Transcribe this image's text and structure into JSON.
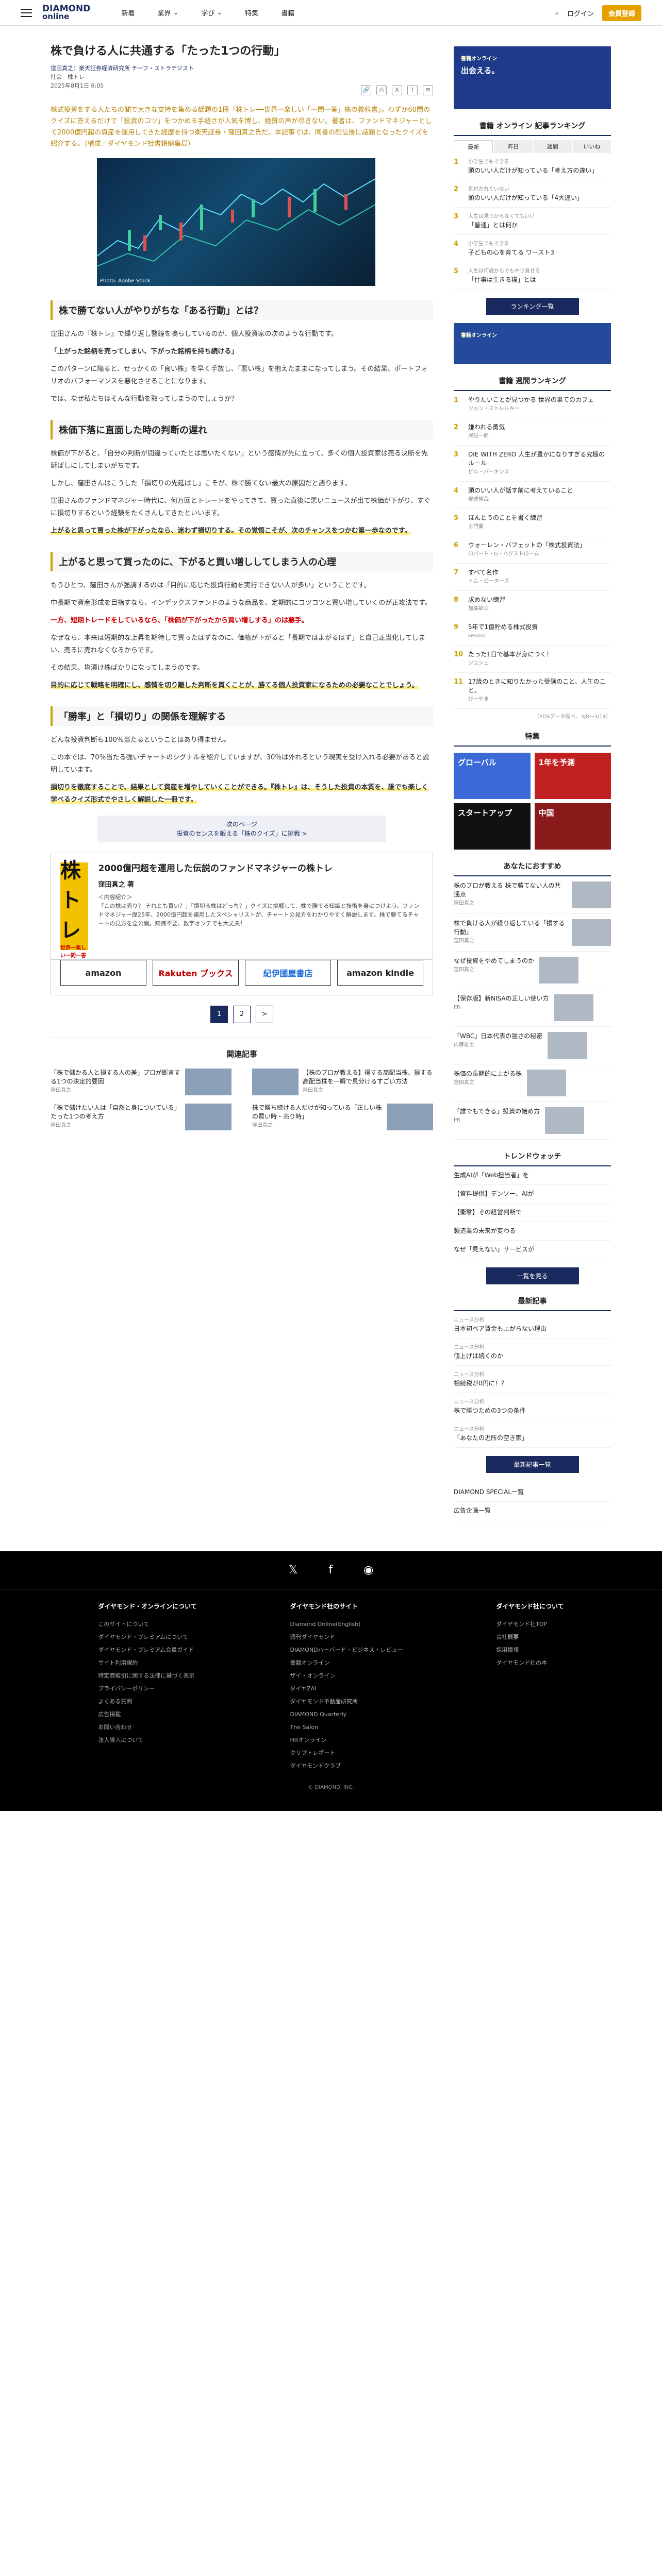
{
  "header": {
    "logo1": "DIAMOND",
    "logo2": "online",
    "nav": [
      "新着",
      "業界",
      "学び",
      "特集",
      "書籍"
    ],
    "login": "ログイン",
    "register": "会員登録"
  },
  "article": {
    "title": "株で負ける人に共通する「たった1つの行動」",
    "author": "窪田真之：楽天証券経済研究所 チーフ・ストラテジスト",
    "sub": "社会　株トレ",
    "date": "2025年8月1日 6:05",
    "lead": "株式投資をする人たちの間で大きな支持を集める話題の1冊『株トレ──世界一楽しい「一問一答」株の教科書』。わずか60問のクイズに答えるだけで「投資のコツ」をつかめる手軽さが人気を博し、絶賛の声が尽きない。著者は、ファンドマネジャーとして2000億円超の資産を運用してきた経歴を持つ楽天証券・窪田真之氏だ。本記事では、同書の配信後に話題となったクイズを紹介する。（構成／ダイヤモンド社書籍編集局）",
    "caption": "Photo: Adobe Stock",
    "h1": "株で勝てない人がやりがちな「ある行動」とは？",
    "p1": "窪田さんの『株トレ』で繰り返し警鐘を鳴らしているのが、個人投資家の次のような行動です。",
    "p2": "「上がった銘柄を売ってしまい、下がった銘柄を持ち続ける」",
    "p3": "このパターンに陥ると、せっかくの「良い株」を早く手放し、「悪い株」を抱えたままになってしまう。その結果、ポートフォリオのパフォーマンスを悪化させることになります。",
    "p4": "では、なぜ私たちはそんな行動を取ってしまうのでしょうか？",
    "h2": "株価下落に直面した時の判断の遅れ",
    "p5": "株価が下がると、「自分の判断が間違っていたとは思いたくない」という感情が先に立って、多くの個人投資家は売る決断を先延ばしにしてしまいがちです。",
    "p6": "しかし、窪田さんはこうした「損切りの先延ばし」こそが、株で勝てない最大の原因だと語ります。",
    "p7": "窪田さんのファンドマネジャー時代に、何万回とトレードをやってきて、買った直後に悪いニュースが出て株価が下がり、すぐに損切りするという経験をたくさんしてきたといいます。",
    "p8": "上がると思って買った株が下がったなら、迷わず損切りする。その覚悟こそが、次のチャンスをつかむ第一歩なのです。",
    "h3": "上がると思って買ったのに、下がると買い増ししてしまう人の心理",
    "p9": "もうひとつ、窪田さんが強調するのは「目的に応じた投資行動を実行できない人が多い」ということです。",
    "p10": "中長期で資産形成を目指すなら、インデックスファンドのような商品を、定期的にコツコツと買い増していくのが正攻法です。",
    "p11": "一方、短期トレードをしているなら、「株価が下がったから買い増しする」のは悪手。",
    "p12": "なぜなら、本来は短期的な上昇を期待して買ったはずなのに、価格が下がると「長期ではよがるはず」と自己正当化してしまい、売るに売れなくなるからです。",
    "p13": "その結果、塩漬け株ばかりになってしまうのです。",
    "p14": "目的に応じて戦略を明確にし、感情を切り離した判断を貫くことが、勝てる個人投資家になるための必要なことでしょう。",
    "h4": "「勝率」と「損切り」の関係を理解する",
    "p15": "どんな投資判断も100％当たるということはあり得ません。",
    "p16": "この本では、70％当たる強いチャートのシグナルを紹介していますが、30％は外れるという現実を受け入れる必要があると説明しています。",
    "p17": "損切りを徹底することで、結果として資産を増やしていくことができる。『株トレ』は、そうした投資の本質を、誰でも楽しく学べるクイズ形式でやさしく解説した一冊です。",
    "next1": "次のページ",
    "next2": "投資のセンスを鍛える「株のクイズ」に挑戦 >"
  },
  "book": {
    "cover": "株トレ",
    "cover_sub": "世界一楽しい一問一答",
    "title": "2000億円超を運用した伝説のファンドマネジャーの株トレ",
    "author": "窪田真之 著",
    "label": "＜内容紹介＞",
    "desc": "「この株は売り？ それとも買い？」「損切る株はどっち？」クイズに挑戦して、株で勝てる知識と技術を身につけよう。ファンドマネジャー歴25年、2000億円超を運用したスペシャリストが、チャートの見方をわかりやすく解説します。株で勝てるチャートの見方を全公開。知識不要、数字オンチでも大丈夫！",
    "shops": [
      "amazon",
      "Rakuten ブックス",
      "紀伊國屋書店",
      "amazon kindle"
    ]
  },
  "pager": [
    "1",
    "2",
    ">"
  ],
  "related": {
    "title": "関連記事",
    "items": [
      {
        "t": "「株で儲かる人と損する人の差」プロが断言する1つの決定的要因",
        "a": "窪田真之"
      },
      {
        "t": "【株のプロが教える】得する高配当株、損する高配当株を一瞬で見分けるすごい方法",
        "a": "窪田真之"
      },
      {
        "t": "「株で儲けたい人は「自然と身についている」たった1つの考え方",
        "a": "窪田真之"
      },
      {
        "t": "株で勝ち続ける人だけが知っている「正しい株の買い時・売り時」",
        "a": "窪田真之"
      }
    ]
  },
  "side": {
    "banner": "出会える。",
    "banner_sub": "書籍オンライン",
    "rank_title": "書籍 オンライン 記事ランキング",
    "tabs": [
      "最新",
      "昨日",
      "週間",
      "いいね"
    ],
    "rank": [
      {
        "n": "1",
        "t": "小学生でもできる",
        "s": "頭のいい人だけが知っている「考え方の違い」"
      },
      {
        "n": "2",
        "t": "気付かれていない",
        "s": "頭のいい人だけが知っている「4大違い」"
      },
      {
        "n": "3",
        "t": "人生は見つからなくてもいい",
        "s": "「普通」とは何か"
      },
      {
        "n": "4",
        "t": "小学生でもできる",
        "s": "子どもの心を育てる ワースト3"
      },
      {
        "n": "5",
        "t": "人生は何歳からでもやり直せる",
        "s": "「仕事は生きる糧」とは"
      }
    ],
    "rank_more": "ランキング一覧",
    "weekly_title": "書籍 週間ランキング",
    "weekly": [
      {
        "n": "1",
        "t": "やりたいことが見つかる 世界の果てのカフェ",
        "s": "ジョン・ストレルキー"
      },
      {
        "n": "2",
        "t": "嫌われる勇気",
        "s": "岸見一郎"
      },
      {
        "n": "3",
        "t": "DIE WITH ZERO 人生が豊かになりすぎる究極のルール",
        "s": "ビル・パーキンス"
      },
      {
        "n": "4",
        "t": "頭のいい人が話す前に考えていること",
        "s": "安達裕哉"
      },
      {
        "n": "5",
        "t": "ほんとうのことを書く練習",
        "s": "土門蘭"
      },
      {
        "n": "6",
        "t": "ウォーレン・バフェットの「株式投資法」",
        "s": "ロバート・G・ハグストローム"
      },
      {
        "n": "7",
        "t": "すべて名作",
        "s": "トム・ピーターズ"
      },
      {
        "n": "8",
        "t": "求めない練習",
        "s": "加藤諦三"
      },
      {
        "n": "9",
        "t": "5年で1億貯める株式投資",
        "s": "kenmo"
      },
      {
        "n": "10",
        "t": "たった1日で基本が身につく！",
        "s": "ジョシュ"
      },
      {
        "n": "11",
        "t": "17歳のときに知りたかった受験のこと、人生のこと。",
        "s": "びーやま"
      }
    ],
    "weekly_note": "（POSデータ調べ、3/8〜3/14）",
    "feat_title": "特集",
    "feat": [
      "グローバル",
      "1年を予測",
      "スタートアップ",
      "中国"
    ],
    "rec_title": "あなたにおすすめ",
    "rec": [
      {
        "t": "株のプロが教える 株で勝てない人の共通点",
        "s": "窪田真之"
      },
      {
        "t": "株で負ける人が繰り返している「損する行動」",
        "s": "窪田真之"
      },
      {
        "t": "なぜ投資をやめてしまうのか",
        "s": "窪田真之"
      },
      {
        "t": "【保存版】新NISAの正しい使い方",
        "s": "PR"
      },
      {
        "t": "「WBC」日本代表の強さの秘密",
        "s": "内藤雄士"
      },
      {
        "t": "株価の長期的に上がる株",
        "s": "窪田真之"
      },
      {
        "t": "「誰でもできる」投資の始め方",
        "s": "PR"
      }
    ],
    "trend_title": "トレンドウォッチ",
    "trend": [
      {
        "t": "生成AIが「Web担当者」を",
        "s": ""
      },
      {
        "t": "【資料提供】デンソー、AIが",
        "s": ""
      },
      {
        "t": "【衝撃】その経営判断で",
        "s": ""
      },
      {
        "t": "製造業の未来が変わる",
        "s": ""
      },
      {
        "t": "なぜ「見えない」サービスが",
        "s": ""
      }
    ],
    "trend_more": "一覧を見る",
    "latest_title": "最新記事",
    "latest": [
      {
        "s": "ニュース分析",
        "t": "日本初ベア賃金も上がらない理由"
      },
      {
        "s": "ニュース分析",
        "t": "値上げは続くのか"
      },
      {
        "s": "ニュース分析",
        "t": "相続税が0円に！？"
      },
      {
        "s": "ニュース分析",
        "t": "株で勝つための3つの条件"
      },
      {
        "s": "ニュース分析",
        "t": "「あなたの近所の空き家」"
      }
    ],
    "latest_more": "最新記事一覧",
    "special": "DIAMOND SPECIAL一覧",
    "ads": "広告企画一覧"
  },
  "footer": {
    "social": [
      "𝕏",
      "f",
      "◉"
    ],
    "c1": {
      "h": "ダイヤモンド・オンラインについて",
      "items": [
        "このサイトについて",
        "ダイヤモンド・プレミアムについて",
        "ダイヤモンド・プレミアム会員ガイド",
        "サイト利用規約",
        "特定商取引に関する法律に基づく表示",
        "プライバシーポリシー",
        "よくある質問",
        "広告掲載",
        "お問い合わせ",
        "法人導入について"
      ]
    },
    "c2": {
      "h": "ダイヤモンド社のサイト",
      "items": [
        "Diamond Online(English)",
        "週刊ダイヤモンド",
        "DIAMONDハーバード・ビジネス・レビュー",
        "書籍オンライン",
        "ザイ・オンライン",
        "ダイヤZAi",
        "ダイヤモンド不動産研究所",
        "DIAMOND Quarterly",
        "The Salon",
        "HRオンライン",
        "クリプトレポート",
        "ダイヤモンドクラブ"
      ]
    },
    "c3": {
      "h": "ダイヤモンド社について",
      "items": [
        "ダイヤモンド社TOP",
        "会社概要",
        "採用情報",
        "ダイヤモンド社の本"
      ]
    },
    "copy": "© DIAMOND, INC."
  }
}
